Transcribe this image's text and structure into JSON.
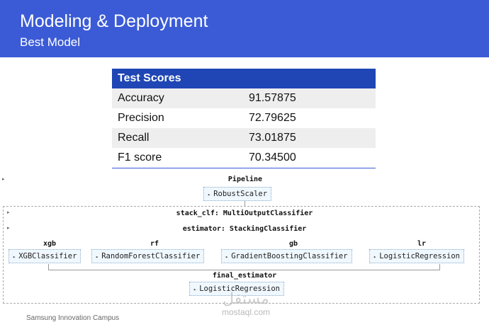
{
  "header": {
    "title": "Modeling & Deployment",
    "subtitle": "Best Model",
    "background": "#3b5bd6"
  },
  "scores_table": {
    "header": "Test Scores",
    "rows": [
      {
        "metric": "Accuracy",
        "value": "91.57875"
      },
      {
        "metric": "Precision",
        "value": "72.79625"
      },
      {
        "metric": "Recall",
        "value": "73.01875"
      },
      {
        "metric": "F1 score",
        "value": "70.34500"
      }
    ]
  },
  "pipeline": {
    "title": "Pipeline",
    "scaler": "RobustScaler",
    "stack_clf": "stack_clf: MultiOutputClassifier",
    "estimator": "estimator: StackingClassifier",
    "estimators": [
      {
        "name": "xgb",
        "model": "XGBClassifier"
      },
      {
        "name": "rf",
        "model": "RandomForestClassifier"
      },
      {
        "name": "gb",
        "model": "GradientBoostingClassifier"
      },
      {
        "name": "lr",
        "model": "LogisticRegression"
      }
    ],
    "final_estimator_label": "final_estimator",
    "final_estimator_model": "LogisticRegression"
  },
  "footer": {
    "text": "Samsung Innovation Campus",
    "logo_arabic": "مستقل",
    "logo_latin": "mostaql.com"
  }
}
